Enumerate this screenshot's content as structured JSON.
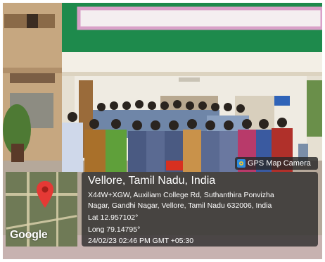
{
  "location_title": "Vellore, Tamil Nadu, India",
  "address_line1": "X44W+XGW, Auxiliam College Rd, Suthanthira Ponvizha",
  "address_line2": "Nagar, Gandhi Nagar, Vellore, Tamil Nadu 632006, India",
  "latitude": "Lat 12.957102°",
  "longitude": "Long 79.14795°",
  "datetime": "24/02/23 02:46 PM GMT +05:30",
  "app_badge": "GPS Map Camera",
  "map_logo": "Google",
  "icons": {
    "pin": "map-pin-icon",
    "badge": "gps-map-camera-icon"
  },
  "colors": {
    "building_green": "#1e8a4c",
    "pin_red": "#e53935",
    "overlay": "#282828"
  }
}
